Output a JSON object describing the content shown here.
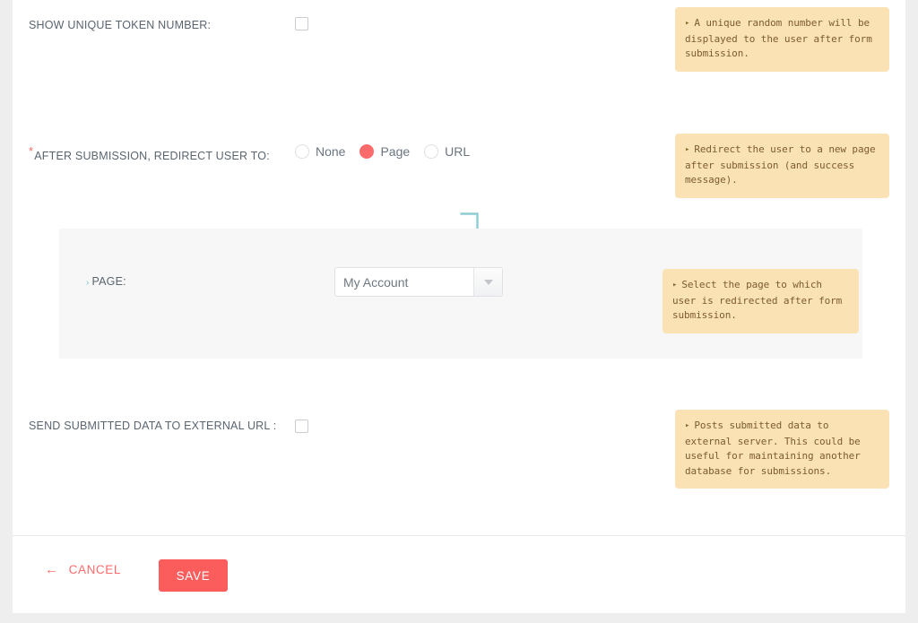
{
  "theme": {
    "page_bg": "#eeeeee",
    "card_bg": "#ffffff",
    "accent": "#fb5c5c",
    "tooltip_bg": "#fbe2b4",
    "tooltip_text": "#7b5c30",
    "subsection_bg": "#f7f7f8",
    "connector": "#7bc6cf",
    "label_text": "#5a6570"
  },
  "fields": {
    "unique_token": {
      "label": "SHOW UNIQUE TOKEN NUMBER:",
      "checked": false,
      "tooltip": "A unique random number will be displayed to the user after form submission."
    },
    "redirect": {
      "label": "AFTER SUBMISSION, REDIRECT USER TO:",
      "required_marker": "*",
      "options": [
        {
          "label": "None",
          "selected": false
        },
        {
          "label": "Page",
          "selected": true
        },
        {
          "label": "URL",
          "selected": false
        }
      ],
      "tooltip": "Redirect the user to a new page after submission (and success message)."
    },
    "page_select": {
      "chevron": "›",
      "label": "PAGE:",
      "value": "My Account",
      "tooltip": "Select the page to which user is redirected after form submission."
    },
    "external_url": {
      "label": "SEND SUBMITTED DATA TO EXTERNAL URL :",
      "checked": false,
      "tooltip": "Posts submitted data to external server. This could be useful for maintaining another database for submissions."
    }
  },
  "tooltip_marker": "▸",
  "footer": {
    "cancel_arrow": "←",
    "cancel_label": "CANCEL",
    "save_label": "SAVE"
  }
}
